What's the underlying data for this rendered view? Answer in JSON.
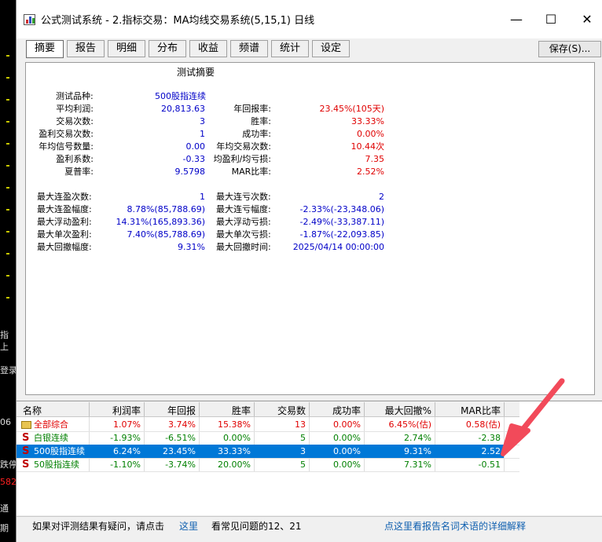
{
  "window": {
    "title": "公式测试系统 - 2.指标交易：MA均线交易系统(5,15,1) 日线",
    "controls": {
      "minimize": "—",
      "maximize": "☐",
      "close": "✕"
    }
  },
  "tabs": [
    "摘要",
    "报告",
    "明细",
    "分布",
    "收益",
    "频谱",
    "统计",
    "设定"
  ],
  "active_tab": "摘要",
  "save_label": "保存(S)...",
  "summary": {
    "heading": "测试摘要",
    "product_label": "测试品种:",
    "product_value": "500股指连续",
    "left_rows": [
      {
        "label": "平均利润:",
        "value": "20,813.63"
      },
      {
        "label": "交易次数:",
        "value": "3"
      },
      {
        "label": "盈利交易次数:",
        "value": "1"
      },
      {
        "label": "年均信号数量:",
        "value": "0.00"
      },
      {
        "label": "盈利系数:",
        "value": "-0.33"
      },
      {
        "label": "夏普率:",
        "value": "9.5798"
      }
    ],
    "right_rows": [
      {
        "label": "年回报率:",
        "value": "23.45%(105天)"
      },
      {
        "label": "胜率:",
        "value": "33.33%"
      },
      {
        "label": "成功率:",
        "value": "0.00%"
      },
      {
        "label": "年均交易次数:",
        "value": "10.44次"
      },
      {
        "label": "均盈利/均亏损:",
        "value": "7.35"
      },
      {
        "label": "MAR比率:",
        "value": "2.52%"
      }
    ],
    "left_rows2": [
      {
        "label": "最大连盈次数:",
        "value": "1"
      },
      {
        "label": "最大连盈幅度:",
        "value": "8.78%(85,788.69)"
      },
      {
        "label": "最大浮动盈利:",
        "value": "14.31%(165,893.36)"
      },
      {
        "label": "最大单次盈利:",
        "value": "7.40%(85,788.69)"
      },
      {
        "label": "最大回撤幅度:",
        "value": "9.31%"
      }
    ],
    "right_rows2": [
      {
        "label": "最大连亏次数:",
        "value": "2"
      },
      {
        "label": "最大连亏幅度:",
        "value": "-2.33%(-23,348.06)"
      },
      {
        "label": "最大浮动亏损:",
        "value": "-2.49%(-33,387.11)"
      },
      {
        "label": "最大单次亏损:",
        "value": "-1.87%(-22,093.85)"
      },
      {
        "label": "最大回撤时间:",
        "value": "2025/04/14 00:00:00"
      }
    ]
  },
  "grid": {
    "headers": [
      "名称",
      "利润率",
      "年回报",
      "胜率",
      "交易数",
      "成功率",
      "最大回撤%",
      "MAR比率"
    ],
    "rows": [
      {
        "icon": "folder-icon",
        "cells": [
          "全部综合",
          "1.07%",
          "3.74%",
          "15.38%",
          "13",
          "0.00%",
          "6.45%(估)",
          "0.58(估)"
        ],
        "color": "#e00000",
        "selected": false
      },
      {
        "icon": "s-icon",
        "cells": [
          "白银连续",
          "-1.93%",
          "-6.51%",
          "0.00%",
          "5",
          "0.00%",
          "2.74%",
          "-2.38"
        ],
        "color": "#008000",
        "selected": false
      },
      {
        "icon": "s-icon",
        "cells": [
          "500股指连续",
          "6.24%",
          "23.45%",
          "33.33%",
          "3",
          "0.00%",
          "9.31%",
          "2.52"
        ],
        "color": "#ffffff",
        "selected": true
      },
      {
        "icon": "s-icon",
        "cells": [
          "50股指连续",
          "-1.10%",
          "-3.74%",
          "20.00%",
          "5",
          "0.00%",
          "7.31%",
          "-0.51"
        ],
        "color": "#008000",
        "selected": false
      }
    ]
  },
  "status": {
    "text1": "如果对评测结果有疑问，请点击",
    "link1": "这里",
    "text2": "看常见问题的12、21",
    "link2": "点这里看报告名词术语的详细解释"
  },
  "background": {
    "labels": [
      "指",
      "上",
      "登录",
      "06",
      "跌停",
      "582",
      "通",
      "期"
    ]
  },
  "colors": {
    "accent": "#0078d7",
    "annotation_arrow": "#f24a5a",
    "positive": "#e00000",
    "negative": "#008000",
    "value_blue": "#0000c8"
  }
}
